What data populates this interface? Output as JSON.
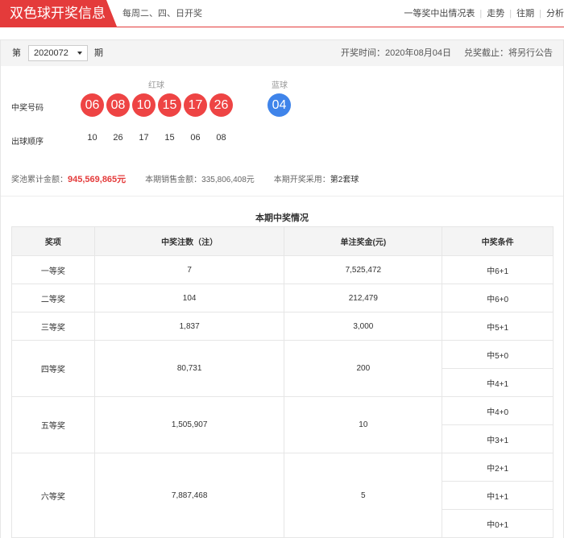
{
  "header": {
    "brand": "双色球开奖信息",
    "schedule": "每周二、四、日开奖",
    "nav": [
      "一等奖中出情况表",
      "走势",
      "往期",
      "分析"
    ]
  },
  "issue": {
    "prefix": "第",
    "selected": "2020072",
    "suffix": "期",
    "draw_date": "开奖时间：2020年08月04日",
    "deadline": "兑奖截止：将另行公告"
  },
  "draw": {
    "red_label": "红球",
    "blue_label": "蓝球",
    "numbers_label": "中奖号码",
    "order_label": "出球顺序",
    "red_balls": [
      "06",
      "08",
      "10",
      "15",
      "17",
      "26"
    ],
    "blue_ball": "04",
    "order": [
      "10",
      "26",
      "17",
      "15",
      "06",
      "08"
    ],
    "colors": {
      "red": "#ee4444",
      "blue": "#3f84ea",
      "accent": "#e43b3b"
    }
  },
  "pool": {
    "label": "奖池累计金额：",
    "amount": "945,569,865元",
    "sales_label": "本期销售金额：",
    "sales": "335,806,408元",
    "method_label": "本期开奖采用：",
    "method": "第2套球"
  },
  "prize_table": {
    "title": "本期中奖情况",
    "headers": [
      "奖项",
      "中奖注数（注）",
      "单注奖金(元)",
      "中奖条件"
    ],
    "rows": [
      {
        "level": "一等奖",
        "count": "7",
        "amount": "7,525,472",
        "conditions": [
          "中6+1"
        ]
      },
      {
        "level": "二等奖",
        "count": "104",
        "amount": "212,479",
        "conditions": [
          "中6+0"
        ]
      },
      {
        "level": "三等奖",
        "count": "1,837",
        "amount": "3,000",
        "conditions": [
          "中5+1"
        ]
      },
      {
        "level": "四等奖",
        "count": "80,731",
        "amount": "200",
        "conditions": [
          "中5+0",
          "中4+1"
        ]
      },
      {
        "level": "五等奖",
        "count": "1,505,907",
        "amount": "10",
        "conditions": [
          "中4+0",
          "中3+1"
        ]
      },
      {
        "level": "六等奖",
        "count": "7,887,468",
        "amount": "5",
        "conditions": [
          "中2+1",
          "中1+1",
          "中0+1"
        ]
      }
    ]
  }
}
